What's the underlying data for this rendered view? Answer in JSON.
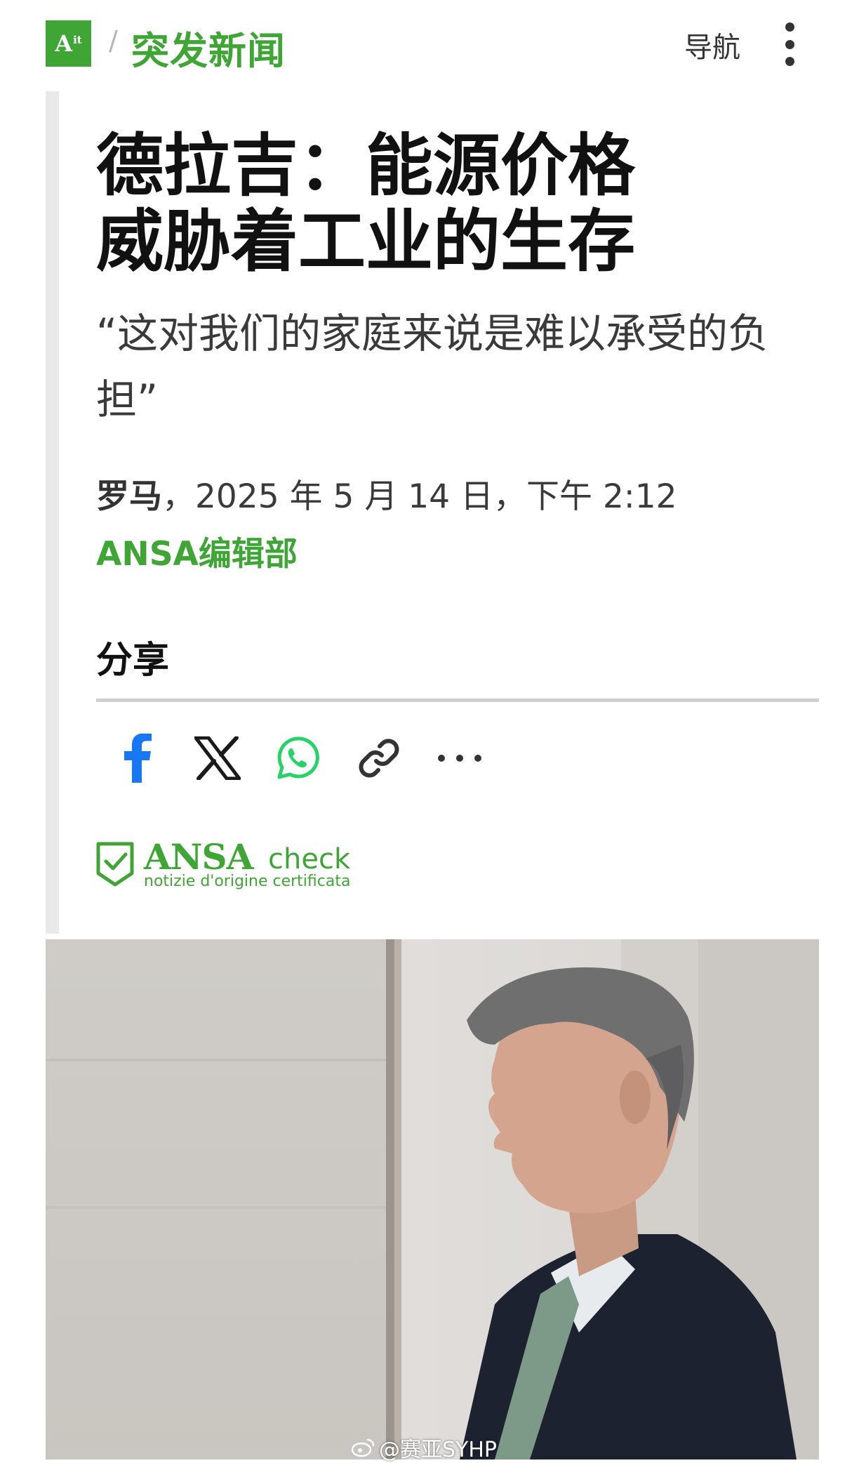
{
  "header": {
    "logo_text": "A",
    "logo_suffix": "it",
    "breadcrumb_separator": "/",
    "section_title": "突发新闻",
    "nav_label": "导航",
    "menu_icon": "vertical-dots-icon"
  },
  "article": {
    "headline_line1": "德拉吉：能源价格",
    "headline_line2": "威胁着工业的生存",
    "subheadline": "“这对我们的家庭来说是难以承受的负担”",
    "dateline_city": "罗马",
    "dateline_rest": "，2025 年 5 月 14 日，下午 2:12",
    "byline": "ANSA编辑部"
  },
  "share": {
    "title": "分享",
    "buttons": [
      {
        "icon": "facebook-icon",
        "color": "#1877f2"
      },
      {
        "icon": "x-icon",
        "color": "#1a1a1a"
      },
      {
        "icon": "whatsapp-icon",
        "color": "#25d366"
      },
      {
        "icon": "link-icon",
        "color": "#333333"
      },
      {
        "icon": "more-horizontal-icon",
        "color": "#333333"
      }
    ]
  },
  "badge": {
    "brand": "ANSA",
    "check": "check",
    "tagline": "notizie d'origine certificata"
  },
  "photo": {
    "watermark": "@赛亚SYHP"
  },
  "colors": {
    "accent": "#3fa535",
    "text": "#111111"
  }
}
